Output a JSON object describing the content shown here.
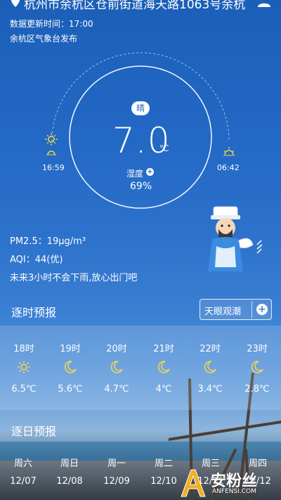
{
  "header": {
    "location": "杭州市余杭区仓前街道海天路1063号余杭",
    "update_time": "数据更新时间：17:00",
    "publisher": "余杭区气象台发布"
  },
  "current": {
    "condition": "晴",
    "temperature": "7.0",
    "unit": "℃",
    "humidity_label": "湿度",
    "humidity_value": "69%",
    "sunrise": "16:59",
    "sunset": "06:42",
    "pm25": "PM2.5：19μg/m³",
    "aqi": "AQI：44(优)",
    "advice": "未来3小时不会下雨,放心出门吧"
  },
  "hourly": {
    "title": "逐时预报",
    "tide_button_label": "天眼观潮",
    "items": [
      {
        "time": "18时",
        "icon": "sun-icon",
        "temp": "6.5℃"
      },
      {
        "time": "19时",
        "icon": "moon-icon",
        "temp": "5.6℃"
      },
      {
        "time": "20时",
        "icon": "moon-icon",
        "temp": "4.7℃"
      },
      {
        "time": "21时",
        "icon": "moon-icon",
        "temp": "4℃"
      },
      {
        "time": "22时",
        "icon": "moon-icon",
        "temp": "3.4℃"
      },
      {
        "time": "23时",
        "icon": "moon-icon",
        "temp": "2.8℃"
      }
    ]
  },
  "daily": {
    "title": "逐日预报",
    "items": [
      {
        "day": "周六",
        "date": "12/07"
      },
      {
        "day": "周日",
        "date": "12/08"
      },
      {
        "day": "周一",
        "date": "12/09"
      },
      {
        "day": "周二",
        "date": "12/10"
      },
      {
        "day": "周三",
        "date": "12/11"
      },
      {
        "day": "周四",
        "date": "12/12"
      }
    ]
  },
  "watermark": {
    "text": "安粉丝",
    "sub": "ANFENSI.COM"
  },
  "colors": {
    "sky_top": "#1b5fb8",
    "accent_blue": "#2a6ac4"
  }
}
